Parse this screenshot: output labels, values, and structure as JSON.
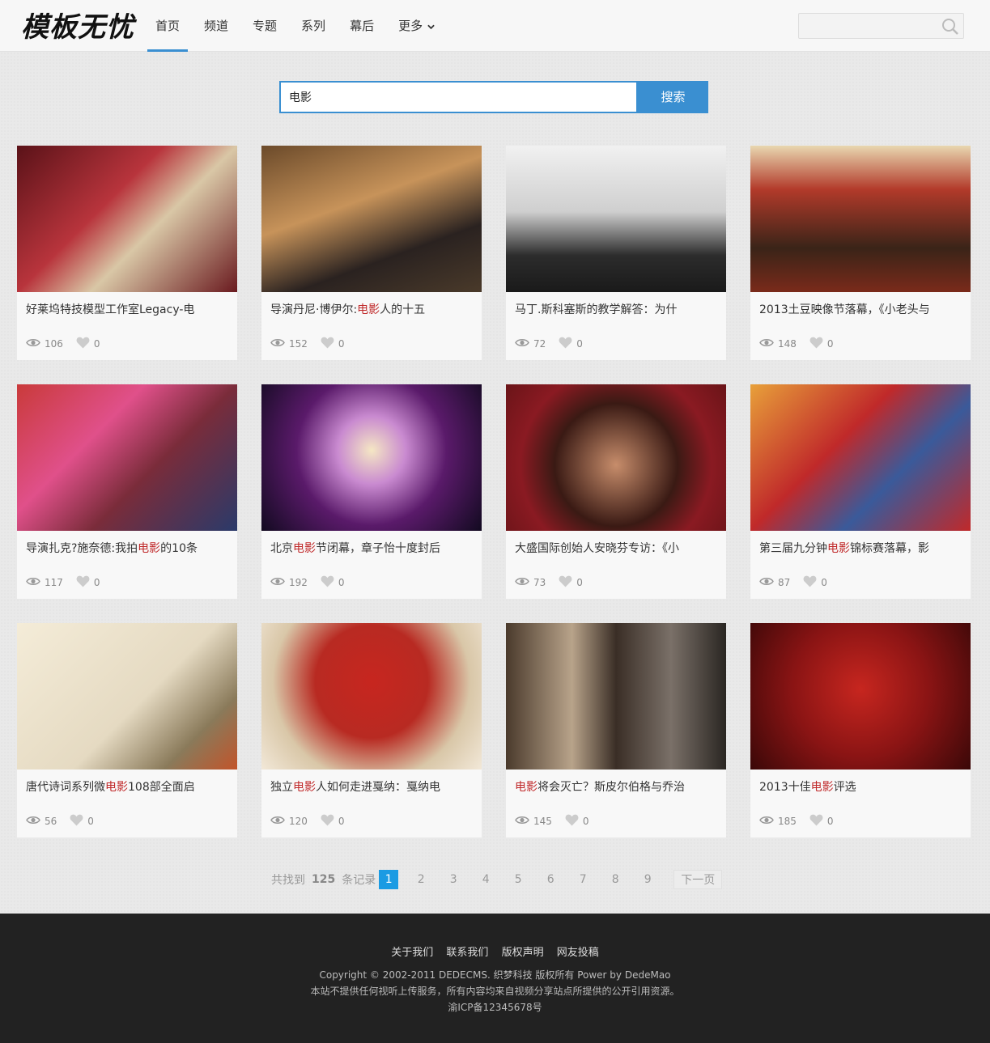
{
  "brand": {
    "logo_text": "模板无忧"
  },
  "nav": {
    "items": [
      {
        "label": "首页",
        "active": true
      },
      {
        "label": "频道"
      },
      {
        "label": "专题"
      },
      {
        "label": "系列"
      },
      {
        "label": "幕后"
      },
      {
        "label": "更多"
      }
    ]
  },
  "top_search": {
    "placeholder": ""
  },
  "search": {
    "query": "电影",
    "button_label": "搜索"
  },
  "cards": [
    {
      "title_pre": "好莱坞特技模型工作室Legacy-电",
      "title_hl": "",
      "title_post": "",
      "views": "106",
      "likes": "0"
    },
    {
      "title_pre": "导演丹尼·博伊尔:",
      "title_hl": "电影",
      "title_post": "人的十五",
      "views": "152",
      "likes": "0"
    },
    {
      "title_pre": "马丁.斯科塞斯的教学解答：为什",
      "title_hl": "",
      "title_post": "",
      "views": "72",
      "likes": "0"
    },
    {
      "title_pre": "2013土豆映像节落幕，《小老头与",
      "title_hl": "",
      "title_post": "",
      "views": "148",
      "likes": "0"
    },
    {
      "title_pre": "导演扎克?施奈德:我拍",
      "title_hl": "电影",
      "title_post": "的10条",
      "views": "117",
      "likes": "0"
    },
    {
      "title_pre": "北京",
      "title_hl": "电影",
      "title_post": "节闭幕，章子怡十度封后",
      "views": "192",
      "likes": "0"
    },
    {
      "title_pre": "大盛国际创始人安晓芬专访：《小",
      "title_hl": "",
      "title_post": "",
      "views": "73",
      "likes": "0"
    },
    {
      "title_pre": "第三届九分钟",
      "title_hl": "电影",
      "title_post": "锦标赛落幕，影",
      "views": "87",
      "likes": "0"
    },
    {
      "title_pre": "唐代诗词系列微",
      "title_hl": "电影",
      "title_post": "108部全面启",
      "views": "56",
      "likes": "0"
    },
    {
      "title_pre": "独立",
      "title_hl": "电影",
      "title_post": "人如何走进戛纳：戛纳电",
      "views": "120",
      "likes": "0"
    },
    {
      "title_pre": "",
      "title_hl": "电影",
      "title_post": "将会灭亡？斯皮尔伯格与乔治",
      "views": "145",
      "likes": "0"
    },
    {
      "title_pre": "2013十佳",
      "title_hl": "电影",
      "title_post": "评选",
      "views": "185",
      "likes": "0"
    }
  ],
  "pagination": {
    "prefix": "共找到",
    "total": "125",
    "suffix": "条记录",
    "pages": [
      "1",
      "2",
      "3",
      "4",
      "5",
      "6",
      "7",
      "8",
      "9"
    ],
    "current": "1",
    "next_label": "下一页"
  },
  "footer": {
    "links": [
      "关于我们",
      "联系我们",
      "版权声明",
      "网友投稿"
    ],
    "copyright": "Copyright © 2002-2011 DEDECMS. 织梦科技 版权所有 Power by DedeMao",
    "disclaimer": "本站不提供任何视听上传服务，所有内容均来自视频分享站点所提供的公开引用资源。",
    "icp": "渝ICP备12345678号"
  },
  "colors": {
    "accent": "#3a8fd1",
    "highlight": "#c0292a",
    "footer_bg": "#222222",
    "page_current": "#1b9be3"
  },
  "icons": {
    "view": "eye-icon",
    "like": "heart-icon",
    "search": "search-icon",
    "more": "chevron-down-icon"
  }
}
